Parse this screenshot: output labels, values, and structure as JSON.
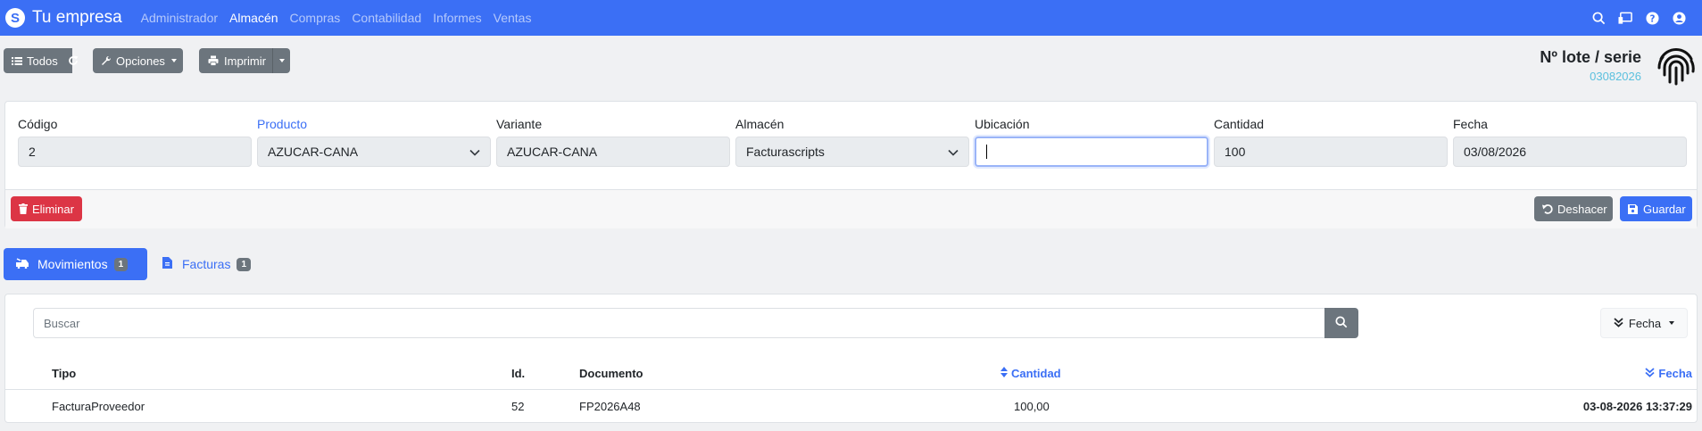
{
  "brand": {
    "name": "Tu empresa",
    "logo_glyph": "S"
  },
  "nav": {
    "items": [
      {
        "label": "Administrador",
        "active": false
      },
      {
        "label": "Almacén",
        "active": true
      },
      {
        "label": "Compras",
        "active": false
      },
      {
        "label": "Contabilidad",
        "active": false
      },
      {
        "label": "Informes",
        "active": false
      },
      {
        "label": "Ventas",
        "active": false
      }
    ],
    "right_icons": [
      "search-icon",
      "cast-icon",
      "help-icon",
      "user-icon"
    ]
  },
  "toolbar": {
    "all_label": "Todos",
    "options_label": "Opciones",
    "print_label": "Imprimir"
  },
  "page": {
    "title": "Nº lote / serie",
    "subtitle": "03082026"
  },
  "form": {
    "fields": [
      {
        "label": "Código",
        "value": "2",
        "type": "text"
      },
      {
        "label": "Producto",
        "value": "AZUCAR-CANA",
        "type": "select"
      },
      {
        "label": "Variante",
        "value": "AZUCAR-CANA",
        "type": "text"
      },
      {
        "label": "Almacén",
        "value": "Facturascripts",
        "type": "select"
      },
      {
        "label": "Ubicación",
        "value": "",
        "type": "focus"
      },
      {
        "label": "Cantidad",
        "value": "100",
        "type": "text"
      },
      {
        "label": "Fecha",
        "value": "03/08/2026",
        "type": "text"
      }
    ],
    "delete_label": "Eliminar",
    "undo_label": "Deshacer",
    "save_label": "Guardar"
  },
  "tabs": [
    {
      "label": "Movimientos",
      "count": "1",
      "active": true
    },
    {
      "label": "Facturas",
      "count": "1",
      "active": false
    }
  ],
  "movements": {
    "search_placeholder": "Buscar",
    "sort_label": "Fecha",
    "columns": [
      "Tipo",
      "Id.",
      "Documento",
      "Cantidad",
      "Fecha"
    ],
    "rows": [
      {
        "tipo": "FacturaProveedor",
        "id": "52",
        "documento": "FP2026A48",
        "cantidad": "100,00",
        "fecha": "03-08-2026 13:37:29"
      }
    ]
  },
  "colors": {
    "primary": "#3b6ff5",
    "secondary": "#6c757d",
    "danger": "#dc3545",
    "info": "#5bc0de"
  }
}
